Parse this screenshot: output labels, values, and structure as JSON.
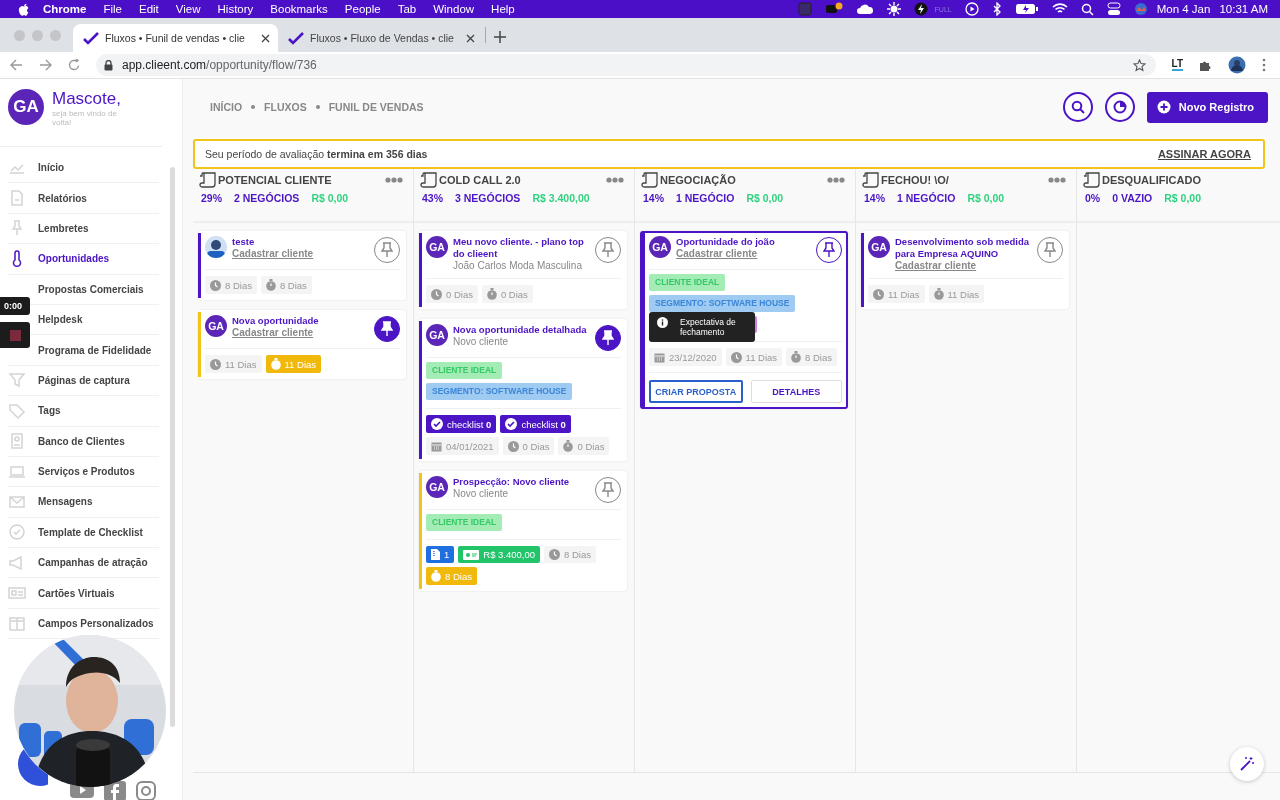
{
  "menubar": {
    "app": "Chrome",
    "menus": [
      "File",
      "Edit",
      "View",
      "History",
      "Bookmarks",
      "People",
      "Tab",
      "Window",
      "Help"
    ],
    "battery_status": "FULL",
    "date": "Mon 4 Jan",
    "time": "10:31 AM"
  },
  "browser": {
    "tabs": [
      {
        "title": "Fluxos • Funil de vendas • clie",
        "selected": true
      },
      {
        "title": "Fluxos • Fluxo de Vendas • clie",
        "selected": false
      }
    ],
    "url_host": "app.clieent.com",
    "url_path": "/opportunity/flow/736",
    "extension_label": "LT"
  },
  "sidebar": {
    "avatar": "GA",
    "name": "Mascote,",
    "greeting": "seja bem vindo de volta!",
    "items": [
      {
        "label": "Início",
        "selected": false
      },
      {
        "label": "Relatórios",
        "selected": false
      },
      {
        "label": "Lembretes",
        "selected": false
      },
      {
        "label": "Oportunidades",
        "selected": true
      },
      {
        "label": "Propostas Comerciais",
        "selected": false
      },
      {
        "label": "Helpdesk",
        "selected": false
      },
      {
        "label": "Programa de Fidelidade",
        "selected": false
      },
      {
        "label": "Páginas de captura",
        "selected": false
      },
      {
        "label": "Tags",
        "selected": false
      },
      {
        "label": "Banco de Clientes",
        "selected": false
      },
      {
        "label": "Serviços e Produtos",
        "selected": false
      },
      {
        "label": "Mensagens",
        "selected": false
      },
      {
        "label": "Template de Checklist",
        "selected": false
      },
      {
        "label": "Campanhas de atração",
        "selected": false
      },
      {
        "label": "Cartões Virtuais",
        "selected": false
      },
      {
        "label": "Campos Personalizados",
        "selected": false
      }
    ]
  },
  "recorder": {
    "time": "0:00"
  },
  "header": {
    "breadcrumb": [
      "INÍCIO",
      "FLUXOS",
      "FUNIL DE VENDAS"
    ],
    "new_button": "Novo Registro"
  },
  "banner": {
    "text": "Seu período de avaliação **termina em 356 dias**",
    "action": "ASSINAR AGORA"
  },
  "columns": [
    {
      "title": "POTENCIAL CLIENTE",
      "percent": "29%",
      "count": "2 NEGÓCIOS",
      "amount": "R$ 0,00",
      "menu": true,
      "cards": [
        {
          "title": "teste",
          "subtitle": "Cadastrar cliente",
          "subtitle_link": true,
          "pinned": false,
          "highlighted": false,
          "color": "#4b14c4",
          "meta": [
            {
              "kind": "clock",
              "text": "8 Dias",
              "alert": false
            },
            {
              "kind": "timer",
              "text": "8 Dias",
              "alert": false
            }
          ]
        },
        {
          "avatar": "GA",
          "title": "Nova oportunidade",
          "subtitle": "Cadastrar cliente",
          "subtitle_link": true,
          "pinned": true,
          "highlighted": false,
          "color": "#f0c419",
          "meta": [
            {
              "kind": "clock",
              "text": "11 Dias",
              "alert": false
            },
            {
              "kind": "timer",
              "text": "11 Dias",
              "alert": true
            }
          ]
        }
      ]
    },
    {
      "title": "COLD CALL 2.0",
      "percent": "43%",
      "count": "3 NEGÓCIOS",
      "amount": "R$ 3.400,00",
      "menu": true,
      "cards": [
        {
          "avatar": "GA",
          "title": "Meu novo cliente. - plano top do clieent",
          "subtitle": "João Carlos Moda Masculina",
          "subtitle_link": false,
          "pinned": false,
          "highlighted": false,
          "color": "#4b14c4",
          "meta": [
            {
              "kind": "clock",
              "text": "0 Dias",
              "alert": false
            },
            {
              "kind": "timer",
              "text": "0 Dias",
              "alert": false
            }
          ]
        },
        {
          "avatar": "GA",
          "title": "Nova oportunidade detalhada",
          "subtitle": "Novo cliente",
          "subtitle_link": false,
          "pinned": true,
          "highlighted": false,
          "color": "#4b14c4",
          "tags": [
            {
              "label": "CLIENTE IDEAL",
              "color": "#a3ecb6"
            },
            {
              "label": "SEGMENTO: SOFTWARE HOUSE",
              "color": "#9fcaf2"
            }
          ],
          "meta": [
            {
              "kind": "checklist",
              "text": "checklist **0**",
              "alert": false
            },
            {
              "kind": "checklist",
              "text": "checklist **0**",
              "alert": false
            },
            {
              "kind": "date",
              "text": "04/01/2021",
              "alert": false
            },
            {
              "kind": "clock",
              "text": "0 Dias",
              "alert": false
            },
            {
              "kind": "timer",
              "text": "0 Dias",
              "alert": false
            }
          ]
        },
        {
          "avatar": "GA",
          "title": "Prospecção: Novo cliente",
          "subtitle": "Novo cliente",
          "subtitle_link": false,
          "pinned": false,
          "highlighted": false,
          "color": "#f0c419",
          "tags": [
            {
              "label": "CLIENTE IDEAL",
              "color": "#a3ecb6"
            }
          ],
          "meta": [
            {
              "kind": "files",
              "text": "1",
              "alert": false
            },
            {
              "kind": "money",
              "text": "R$ 3.400,00",
              "alert": false
            },
            {
              "kind": "clock",
              "text": "8 Dias",
              "alert": false
            },
            {
              "kind": "timer",
              "text": "8 Dias",
              "alert": true
            }
          ]
        }
      ]
    },
    {
      "title": "NEGOCIAÇÃO",
      "percent": "14%",
      "count": "1 NEGÓCIO",
      "amount": "R$ 0,00",
      "menu": true,
      "cards": [
        {
          "avatar": "GA",
          "title": "Oportunidade do joão",
          "subtitle": "Cadastrar cliente",
          "subtitle_link": true,
          "pinned": false,
          "highlighted": true,
          "color": "#4b14c4",
          "tags": [
            {
              "label": "CLIENTE IDEAL",
              "color": "#a3ecb6"
            },
            {
              "label": "SEGMENTO: SOFTWARE HOUSE",
              "color": "#9fcaf2"
            },
            {
              "color": "#cf7ee0"
            }
          ],
          "tooltip": "Expectativa de fechamento",
          "meta": [
            {
              "kind": "date",
              "text": "23/12/2020",
              "alert": false
            },
            {
              "kind": "clock",
              "text": "11 Dias",
              "alert": false
            },
            {
              "kind": "timer",
              "text": "8 Dias",
              "alert": false
            }
          ],
          "actions": [
            "CRIAR PROPOSTA",
            "DETALHES"
          ]
        }
      ]
    },
    {
      "title": "FECHOU! \\O/",
      "percent": "14%",
      "count": "1 NEGÓCIO",
      "amount": "R$ 0,00",
      "menu": true,
      "cards": [
        {
          "avatar": "GA",
          "title": "Desenvolvimento sob medida para Empresa AQUINO",
          "subtitle": "Cadastrar cliente",
          "subtitle_link": true,
          "pinned": false,
          "highlighted": false,
          "color": "#4b14c4",
          "meta": [
            {
              "kind": "clock",
              "text": "11 Dias",
              "alert": false
            },
            {
              "kind": "timer",
              "text": "11 Dias",
              "alert": false
            }
          ]
        }
      ]
    },
    {
      "title": "DESQUALIFICADO",
      "percent": "0%",
      "count": "0 VAZIO",
      "amount": "R$ 0,00",
      "menu": false
    }
  ]
}
